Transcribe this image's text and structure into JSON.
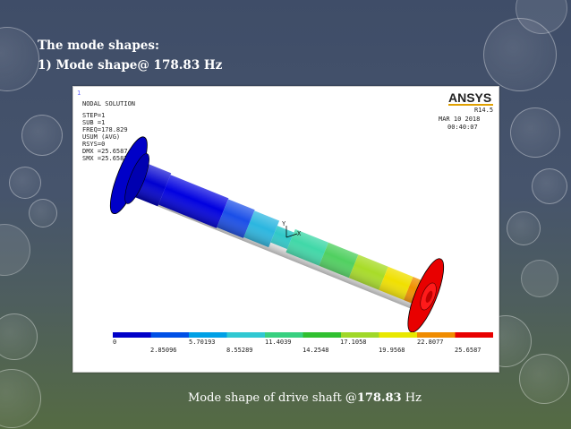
{
  "slide": {
    "heading_line1": "The mode shapes:",
    "heading_line2": "1) Mode shape@ 178.83 Hz",
    "caption_text": "Mode shape of drive shaft @",
    "caption_value": "178.83",
    "caption_unit": " Hz"
  },
  "ansys": {
    "window_number": "1",
    "title": "NODAL SOLUTION",
    "info_lines": [
      "STEP=1",
      "SUB =1",
      "FREQ=178.829",
      "USUM    (AVG)",
      "RSYS=0",
      "DMX =25.6587",
      "SMX =25.6587"
    ],
    "logo": "ANSYS",
    "version": "R14.5",
    "date": "MAR 10 2018",
    "time": "00:40:07",
    "axis_y": "Y",
    "axis_x": "X",
    "legend_top_labels": [
      "0",
      "5.70193",
      "11.4039",
      "17.1058",
      "22.8077"
    ],
    "legend_bottom_labels": [
      "2.85096",
      "8.55289",
      "14.2548",
      "19.9568",
      "25.6587"
    ],
    "legend_colors": [
      "#0000c8",
      "#0050e6",
      "#00a0e6",
      "#30c8d2",
      "#38d080",
      "#30c030",
      "#a0d828",
      "#e8e800",
      "#f08c00",
      "#e80000"
    ]
  }
}
